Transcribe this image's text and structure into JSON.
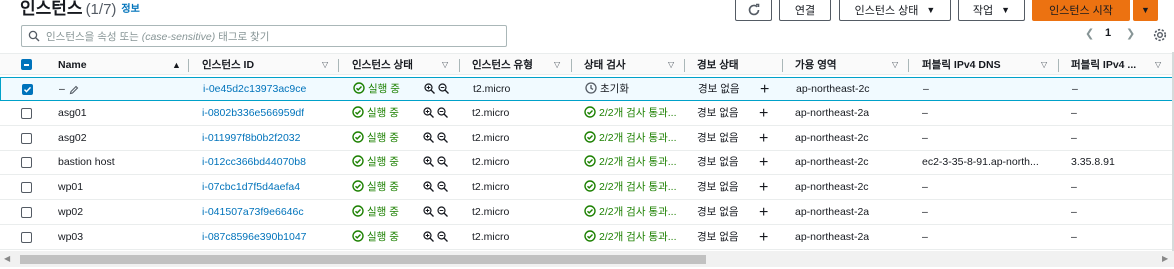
{
  "header": {
    "title": "인스턴스",
    "count": "(1/7)",
    "info": "정보"
  },
  "actions": {
    "connect": "연결",
    "instance_state": "인스턴스 상태",
    "actions": "작업",
    "launch": "인스턴스 시작"
  },
  "search": {
    "placeholder_prefix": "인스턴스을 속성 또는",
    "placeholder_italic": "(case-sensitive)",
    "placeholder_suffix": "태그로 찾기"
  },
  "pagination": {
    "page": "1"
  },
  "columns": {
    "name": "Name",
    "instance_id": "인스턴스 ID",
    "state": "인스턴스 상태",
    "type": "인스턴스 유형",
    "status_check": "상태 검사",
    "alarm": "경보 상태",
    "az": "가용 영역",
    "dns": "퍼블릭 IPv4 DNS",
    "ip": "퍼블릭 IPv4 ..."
  },
  "rows": [
    {
      "name": "–",
      "id": "i-0e45d2c13973ac9ce",
      "state": "실행 중",
      "type": "t2.micro",
      "check": "초기화",
      "alarm": "경보 없음",
      "az": "ap-northeast-2c",
      "dns": "–",
      "ip": "–",
      "selected": true
    },
    {
      "name": "asg01",
      "id": "i-0802b336e566959df",
      "state": "실행 중",
      "type": "t2.micro",
      "check": "2/2개 검사 통과...",
      "alarm": "경보 없음",
      "az": "ap-northeast-2a",
      "dns": "–",
      "ip": "–"
    },
    {
      "name": "asg02",
      "id": "i-011997f8b0b2f2032",
      "state": "실행 중",
      "type": "t2.micro",
      "check": "2/2개 검사 통과...",
      "alarm": "경보 없음",
      "az": "ap-northeast-2c",
      "dns": "–",
      "ip": "–"
    },
    {
      "name": "bastion host",
      "id": "i-012cc366bd44070b8",
      "state": "실행 중",
      "type": "t2.micro",
      "check": "2/2개 검사 통과...",
      "alarm": "경보 없음",
      "az": "ap-northeast-2c",
      "dns": "ec2-3-35-8-91.ap-north...",
      "ip": "3.35.8.91"
    },
    {
      "name": "wp01",
      "id": "i-07cbc1d7f5d4aefa4",
      "state": "실행 중",
      "type": "t2.micro",
      "check": "2/2개 검사 통과...",
      "alarm": "경보 없음",
      "az": "ap-northeast-2c",
      "dns": "–",
      "ip": "–"
    },
    {
      "name": "wp02",
      "id": "i-041507a73f9e6646c",
      "state": "실행 중",
      "type": "t2.micro",
      "check": "2/2개 검사 통과...",
      "alarm": "경보 없음",
      "az": "ap-northeast-2a",
      "dns": "–",
      "ip": "–"
    },
    {
      "name": "wp03",
      "id": "i-087c8596e390b1047",
      "state": "실행 중",
      "type": "t2.micro",
      "check": "2/2개 검사 통과...",
      "alarm": "경보 없음",
      "az": "ap-northeast-2a",
      "dns": "–",
      "ip": "–"
    }
  ],
  "colors": {
    "link": "#0073bb",
    "success": "#1d8102",
    "primary": "#ec7211"
  }
}
